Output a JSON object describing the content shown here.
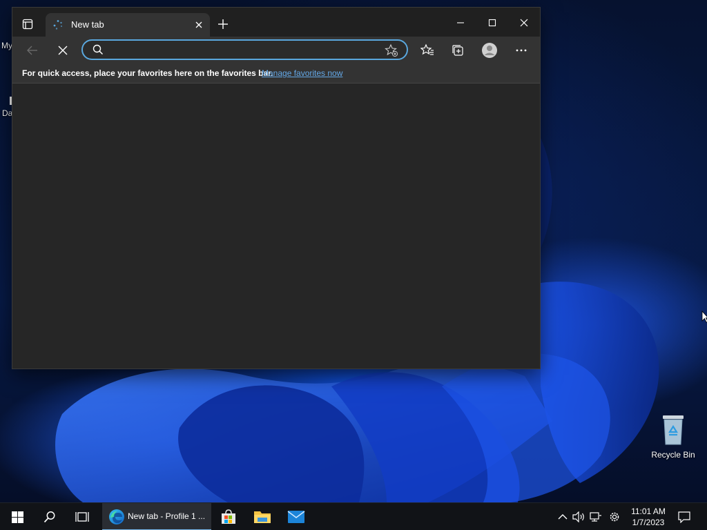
{
  "desktop": {
    "edge_labels": [
      "My",
      "Da"
    ],
    "recycle_bin_label": "Recycle Bin"
  },
  "browser": {
    "tab": {
      "title": "New tab"
    },
    "address_bar": {
      "value": "",
      "placeholder": ""
    },
    "favorites_bar": {
      "text": "For quick access, place your favorites here on the favorites bar.",
      "link": "Manage favorites now"
    }
  },
  "taskbar": {
    "edge_label": "New tab - Profile 1 ...",
    "clock_time": "11:01 AM",
    "clock_date": "1/7/2023"
  },
  "colors": {
    "accent": "#5aa8df",
    "link": "#64a9e8",
    "titlebar": "#202020",
    "toolbar": "#333333",
    "content": "#262626",
    "taskbar": "#111317"
  },
  "icons": [
    "tab-actions-icon",
    "loading-icon",
    "close-icon",
    "plus-icon",
    "minimize-icon",
    "maximize-icon",
    "back-arrow-icon",
    "stop-icon",
    "search-icon",
    "add-favorite-icon",
    "favorites-icon",
    "collections-icon",
    "profile-icon",
    "more-icon",
    "windows-start-icon",
    "task-view-icon",
    "edge-icon",
    "store-icon",
    "folder-icon",
    "mail-icon",
    "chevron-up-icon",
    "volume-icon",
    "network-icon",
    "gear-icon",
    "notification-icon",
    "recycle-bin-icon",
    "mouse-cursor-icon"
  ]
}
